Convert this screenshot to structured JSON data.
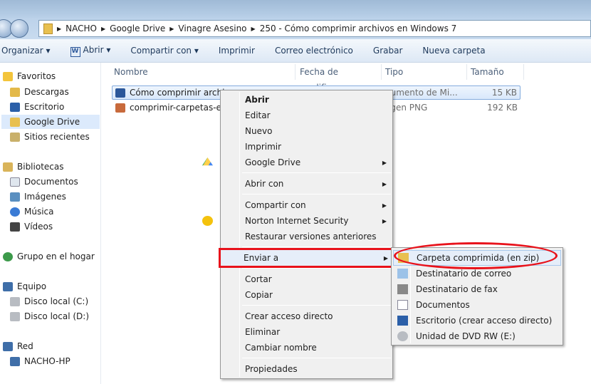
{
  "address": {
    "crumbs": [
      "NACHO",
      "Google Drive",
      "Vinagre Asesino",
      "250 - Cómo comprimir archivos en Windows 7"
    ]
  },
  "toolbar": [
    "Organizar ▾",
    "Abrir ▾",
    "Compartir con ▾",
    "Imprimir",
    "Correo electrónico",
    "Grabar",
    "Nueva carpeta"
  ],
  "sidebar": {
    "favoritos": "Favoritos",
    "fav_items": [
      "Descargas",
      "Escritorio",
      "Google Drive",
      "Sitios recientes"
    ],
    "bibliotecas": "Bibliotecas",
    "lib_items": [
      "Documentos",
      "Imágenes",
      "Música",
      "Vídeos"
    ],
    "grupo": "Grupo en el hogar",
    "equipo": "Equipo",
    "eq_items": [
      "Disco local (C:)",
      "Disco local (D:)"
    ],
    "red": "Red",
    "red_items": [
      "NACHO-HP"
    ]
  },
  "columns": [
    "Nombre",
    "Fecha de modifica...",
    "Tipo",
    "Tamaño"
  ],
  "files": [
    {
      "name": "Cómo comprimir archivo",
      "type": "cumento de Mi...",
      "size": "15 KB"
    },
    {
      "name": "comprimir-carpetas-en-",
      "type": "agen PNG",
      "size": "192 KB"
    }
  ],
  "context_menu": [
    "Abrir",
    "Editar",
    "Nuevo",
    "Imprimir",
    "Google Drive",
    "Abrir con",
    "Compartir con",
    "Norton Internet Security",
    "Restaurar versiones anteriores",
    "Enviar a",
    "Cortar",
    "Copiar",
    "Crear acceso directo",
    "Eliminar",
    "Cambiar nombre",
    "Propiedades"
  ],
  "send_to_menu": [
    "Carpeta comprimida (en zip)",
    "Destinatario de correo",
    "Destinatario de fax",
    "Documentos",
    "Escritorio (crear acceso directo)",
    "Unidad de DVD RW (E:)"
  ],
  "highlight_color": "#e8121b"
}
